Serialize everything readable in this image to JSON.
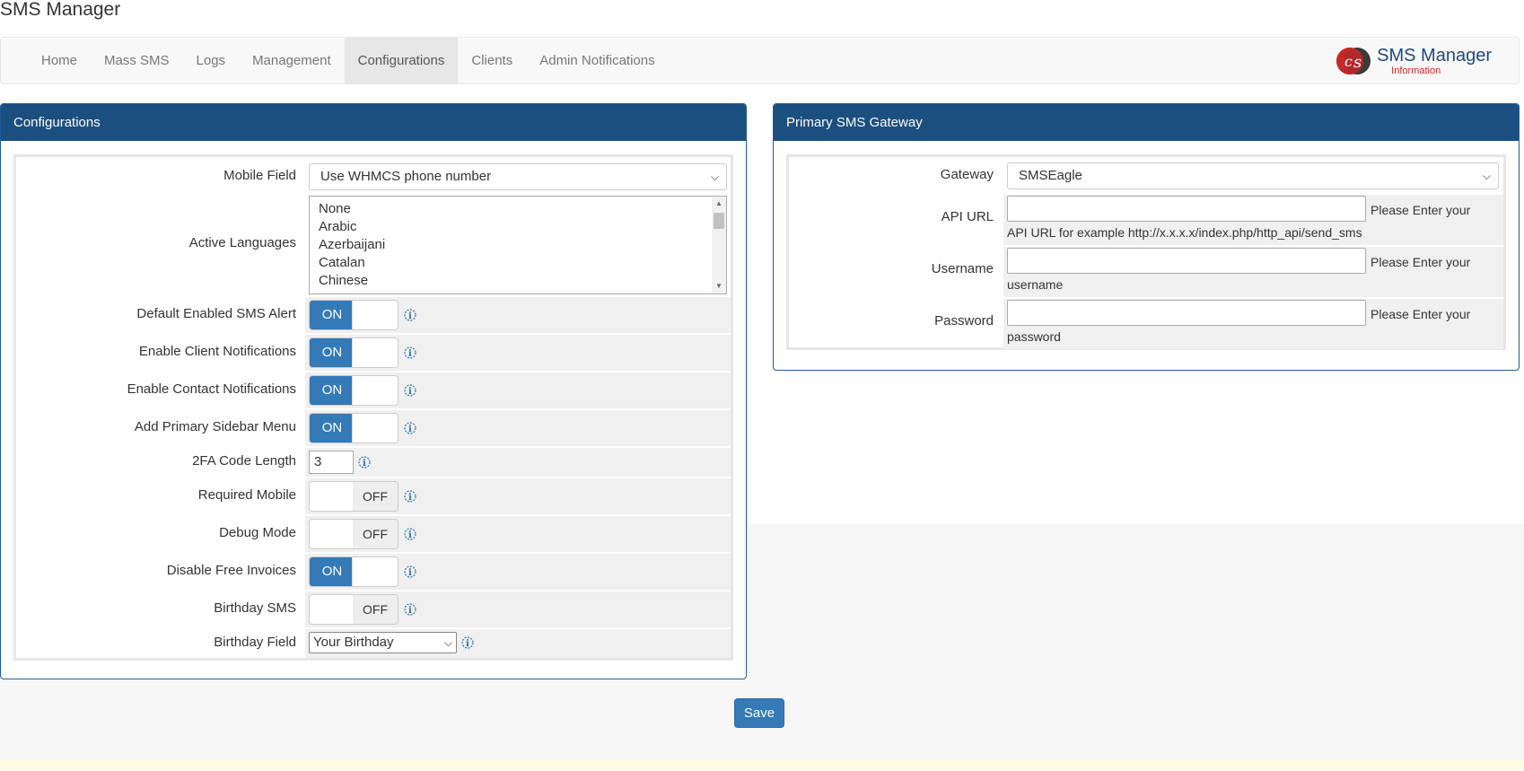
{
  "page": {
    "title": "SMS Manager"
  },
  "nav": {
    "items": [
      {
        "label": "Home"
      },
      {
        "label": "Mass SMS"
      },
      {
        "label": "Logs"
      },
      {
        "label": "Management"
      },
      {
        "label": "Configurations",
        "active": true
      },
      {
        "label": "Clients"
      },
      {
        "label": "Admin Notifications"
      }
    ],
    "logo": {
      "title": "SMS Manager",
      "subtitle": "Information"
    }
  },
  "config_panel": {
    "title": "Configurations",
    "mobile_field": {
      "label": "Mobile Field",
      "value": "Use WHMCS phone number"
    },
    "active_languages": {
      "label": "Active Languages",
      "options": [
        "None",
        "Arabic",
        "Azerbaijani",
        "Catalan",
        "Chinese"
      ]
    },
    "default_sms_alert": {
      "label": "Default Enabled SMS Alert",
      "state": "ON"
    },
    "client_notifications": {
      "label": "Enable Client Notifications",
      "state": "ON"
    },
    "contact_notifications": {
      "label": "Enable Contact Notifications",
      "state": "ON"
    },
    "primary_sidebar": {
      "label": "Add Primary Sidebar Menu",
      "state": "ON"
    },
    "twofa_length": {
      "label": "2FA Code Length",
      "value": "3"
    },
    "required_mobile": {
      "label": "Required Mobile",
      "state": "OFF"
    },
    "debug_mode": {
      "label": "Debug Mode",
      "state": "OFF"
    },
    "disable_free_invoices": {
      "label": "Disable Free Invoices",
      "state": "ON"
    },
    "birthday_sms": {
      "label": "Birthday SMS",
      "state": "OFF"
    },
    "birthday_field": {
      "label": "Birthday Field",
      "value": "Your Birthday"
    }
  },
  "gateway_panel": {
    "title": "Primary SMS Gateway",
    "gateway": {
      "label": "Gateway",
      "value": "SMSEagle"
    },
    "api_url": {
      "label": "API URL",
      "value": "",
      "help1": "Please Enter your",
      "help2": "API URL for example http://x.x.x.x/index.php/http_api/send_sms"
    },
    "username": {
      "label": "Username",
      "value": "",
      "help1": "Please Enter your",
      "help2": "username"
    },
    "password": {
      "label": "Password",
      "value": "",
      "help1": "Please Enter your",
      "help2": "password"
    }
  },
  "actions": {
    "save_label": "Save"
  },
  "colors": {
    "primary": "#337ab7",
    "panel_header": "#1b4f80",
    "brand_red": "#c62828"
  }
}
